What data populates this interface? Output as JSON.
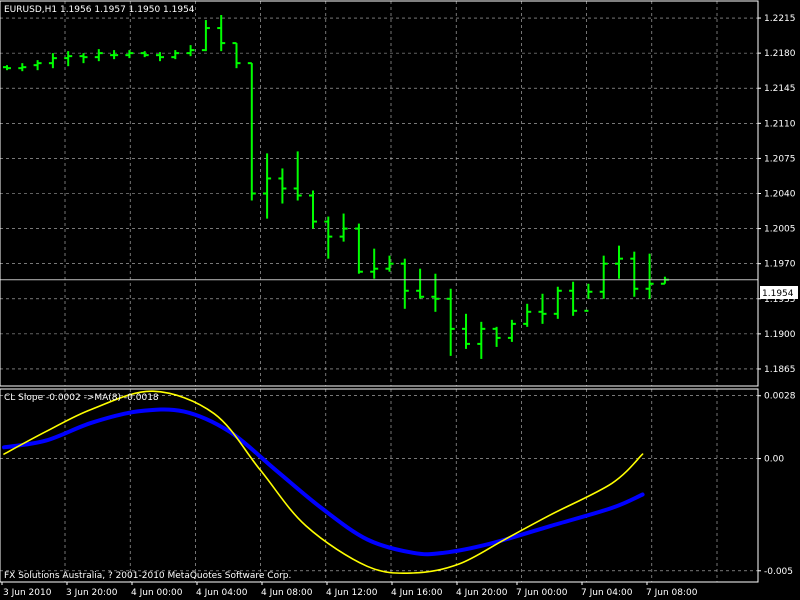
{
  "window": {
    "symbol_header": "EURUSD,H1  1.1956 1.1957 1.1950 1.1954",
    "copyright": "FX Solutions Australia, ? 2001-2010 MetaQuotes Software Corp."
  },
  "colors": {
    "background": "#000000",
    "grid": "#c0c0c0",
    "bars": "#00ff00",
    "price_line": "#c0c0c0",
    "cl_slope": "#ffff00",
    "ma8": "#0000ff",
    "text": "#ffffff"
  },
  "chart_data": [
    {
      "type": "bar",
      "title": "EURUSD,H1  1.1956 1.1957 1.1950 1.1954",
      "ylim": [
        1.1848,
        1.2232
      ],
      "y_ticks": [
        "1.2215",
        "1.2180",
        "1.2145",
        "1.2110",
        "1.2075",
        "1.2040",
        "1.2005",
        "1.1970",
        "1.1935",
        "1.1900",
        "1.1865"
      ],
      "y_tick_values": [
        1.2215,
        1.218,
        1.2145,
        1.211,
        1.2075,
        1.204,
        1.2005,
        1.197,
        1.1935,
        1.19,
        1.1865
      ],
      "current_price_label": "1.1954",
      "current_price": 1.1954,
      "x_ticks": [
        "3 Jun 2010",
        "3 Jun 20:00",
        "4 Jun 00:00",
        "4 Jun 04:00",
        "4 Jun 08:00",
        "4 Jun 12:00",
        "4 Jun 16:00",
        "4 Jun 20:00",
        "7 Jun 00:00",
        "7 Jun 04:00",
        "7 Jun 08:00"
      ],
      "x_tick_bar_index": [
        0,
        4,
        8,
        12,
        16,
        20,
        24,
        28,
        32,
        36,
        40
      ],
      "grid": true,
      "ohlc": [
        [
          1.2166,
          1.2168,
          1.2163,
          1.2165
        ],
        [
          1.2165,
          1.217,
          1.2162,
          1.2166
        ],
        [
          1.2168,
          1.2173,
          1.2163,
          1.217
        ],
        [
          1.217,
          1.218,
          1.2165,
          1.2175
        ],
        [
          1.2175,
          1.2182,
          1.2167,
          1.2177
        ],
        [
          1.2177,
          1.218,
          1.217,
          1.2176
        ],
        [
          1.2176,
          1.2184,
          1.2172,
          1.218
        ],
        [
          1.2178,
          1.2183,
          1.2174,
          1.2178
        ],
        [
          1.2178,
          1.2183,
          1.2175,
          1.218
        ],
        [
          1.218,
          1.2182,
          1.2176,
          1.2178
        ],
        [
          1.2178,
          1.2181,
          1.2172,
          1.2176
        ],
        [
          1.2176,
          1.2183,
          1.2174,
          1.218
        ],
        [
          1.218,
          1.2188,
          1.2177,
          1.2183
        ],
        [
          1.2183,
          1.2213,
          1.2182,
          1.2205
        ],
        [
          1.2205,
          1.2218,
          1.2182,
          1.219
        ],
        [
          1.219,
          1.219,
          1.2165,
          1.217
        ],
        [
          1.217,
          1.217,
          1.2033,
          1.204
        ],
        [
          1.204,
          1.208,
          1.2015,
          1.2055
        ],
        [
          1.2055,
          1.2065,
          1.203,
          1.2045
        ],
        [
          1.2045,
          1.2082,
          1.2033,
          1.2038
        ],
        [
          1.2038,
          1.2043,
          1.2005,
          1.2012
        ],
        [
          1.2012,
          1.2017,
          1.1975,
          1.1997
        ],
        [
          1.1997,
          1.202,
          1.1992,
          1.2005
        ],
        [
          1.2005,
          1.201,
          1.196,
          1.1962
        ],
        [
          1.1962,
          1.1985,
          1.1955,
          1.1965
        ],
        [
          1.1965,
          1.1978,
          1.1962,
          1.197
        ],
        [
          1.197,
          1.1975,
          1.1925,
          1.1943
        ],
        [
          1.1943,
          1.1965,
          1.1935,
          1.1937
        ],
        [
          1.1937,
          1.196,
          1.1922,
          1.1935
        ],
        [
          1.1935,
          1.1945,
          1.1878,
          1.1905
        ],
        [
          1.1905,
          1.192,
          1.1885,
          1.189
        ],
        [
          1.189,
          1.1912,
          1.1875,
          1.1905
        ],
        [
          1.1905,
          1.1907,
          1.1887,
          1.1896
        ],
        [
          1.1896,
          1.1914,
          1.1892,
          1.191
        ],
        [
          1.191,
          1.193,
          1.1907,
          1.1922
        ],
        [
          1.1922,
          1.194,
          1.191,
          1.192
        ],
        [
          1.192,
          1.1947,
          1.1915,
          1.1943
        ],
        [
          1.1943,
          1.1952,
          1.1918,
          1.1923
        ],
        [
          1.1923,
          1.195,
          1.1935,
          1.1942
        ],
        [
          1.1942,
          1.1978,
          1.1935,
          1.197
        ],
        [
          1.197,
          1.1988,
          1.1955,
          1.1975
        ],
        [
          1.1975,
          1.1982,
          1.1937,
          1.1945
        ],
        [
          1.1945,
          1.198,
          1.1935,
          1.195
        ],
        [
          1.195,
          1.1957,
          1.195,
          1.1954
        ]
      ]
    },
    {
      "type": "line",
      "title": "CL Slope -0.0002  ->MA(8) -0.0018",
      "ylim": [
        -0.0055,
        0.0031
      ],
      "y_ticks": [
        "0.0028",
        "0.00",
        "-0.005"
      ],
      "y_tick_values": [
        0.0028,
        0.0,
        -0.005
      ],
      "grid": true,
      "series": [
        {
          "name": "CL Slope",
          "color": "#ffff00",
          "x": [
            0,
            3,
            6,
            10,
            14,
            17,
            20,
            24,
            27,
            30,
            33,
            36,
            40,
            42
          ],
          "values": [
            0.0002,
            0.0012,
            0.0022,
            0.003,
            0.002,
            -0.0005,
            -0.003,
            -0.0048,
            -0.0051,
            -0.0047,
            -0.0036,
            -0.0025,
            -0.0011,
            0.0002
          ]
        },
        {
          "name": "MA(8)",
          "color": "#0000ff",
          "x": [
            0,
            3,
            6,
            9,
            12,
            15,
            18,
            21,
            24,
            27,
            29,
            32,
            36,
            40,
            42
          ],
          "values": [
            0.0005,
            0.0008,
            0.0016,
            0.0021,
            0.0021,
            0.0012,
            -0.0005,
            -0.0022,
            -0.0036,
            -0.0042,
            -0.0042,
            -0.0038,
            -0.003,
            -0.0022,
            -0.0016
          ]
        }
      ]
    }
  ]
}
